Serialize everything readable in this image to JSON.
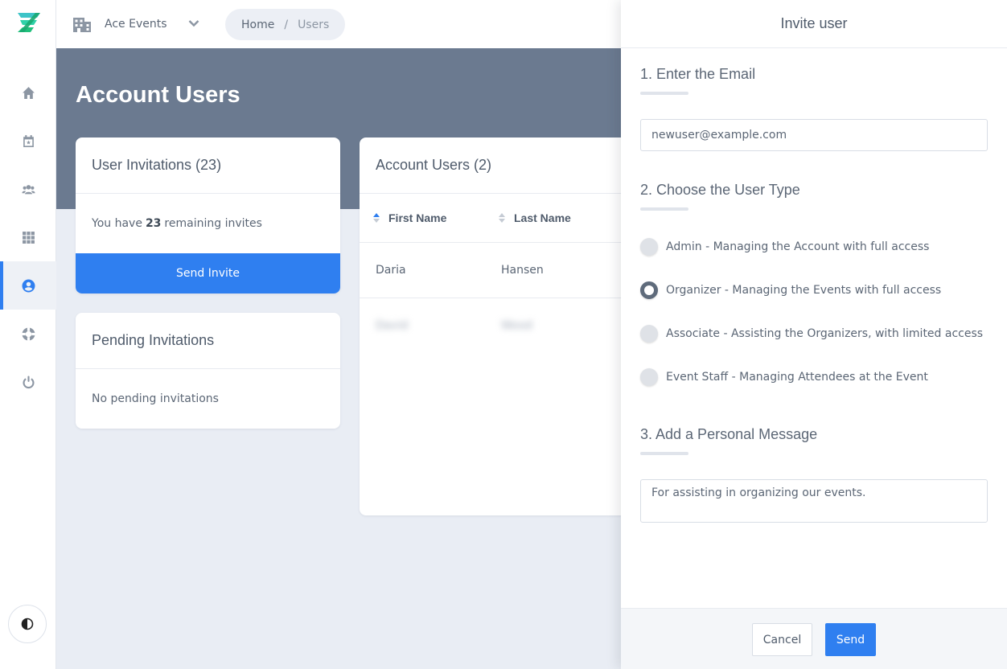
{
  "app": {
    "org_name": "Ace Events"
  },
  "breadcrumb": {
    "home": "Home",
    "separator": "/",
    "current": "Users"
  },
  "sidebar": {
    "items": [
      {
        "name": "home",
        "icon": "home-icon"
      },
      {
        "name": "events",
        "icon": "calendar-icon"
      },
      {
        "name": "attendees",
        "icon": "users-icon"
      },
      {
        "name": "apps",
        "icon": "grid-icon"
      },
      {
        "name": "account-users",
        "icon": "user-circle-icon",
        "active": true
      },
      {
        "name": "support",
        "icon": "lifebuoy-icon"
      },
      {
        "name": "logout",
        "icon": "power-icon"
      }
    ],
    "theme_icon": "contrast-icon"
  },
  "page": {
    "title": "Account Users"
  },
  "invites_card": {
    "title": "User Invitations (23)",
    "text_before": "You have",
    "count": "23",
    "text_after": "remaining invites",
    "button": "Send Invite"
  },
  "pending_card": {
    "title": "Pending Invitations",
    "empty_text": "No pending invitations"
  },
  "users_card": {
    "title": "Account Users (2)",
    "columns": [
      "First Name",
      "Last Name"
    ],
    "rows": [
      {
        "first": "Daria",
        "last": "Hansen",
        "blurred": false
      },
      {
        "first": "David",
        "last": "Wood",
        "blurred": true
      }
    ]
  },
  "panel": {
    "title": "Invite user",
    "step1_title": "1. Enter the Email",
    "email_value": "newuser@example.com",
    "step2_title": "2. Choose the User Type",
    "user_types": [
      {
        "label": "Admin - Managing the Account with full access",
        "checked": false
      },
      {
        "label": "Organizer - Managing the Events with full access",
        "checked": true
      },
      {
        "label": "Associate - Assisting the Organizers, with limited access",
        "checked": false
      },
      {
        "label": "Event Staff - Managing Attendees at the Event",
        "checked": false
      }
    ],
    "step3_title": "3. Add a Personal Message",
    "message_value": "For assisting in organizing our events.",
    "cancel_label": "Cancel",
    "send_label": "Send"
  },
  "colors": {
    "accent": "#2f7ff0",
    "banner": "#6b7a90",
    "background": "#e9edf4"
  }
}
